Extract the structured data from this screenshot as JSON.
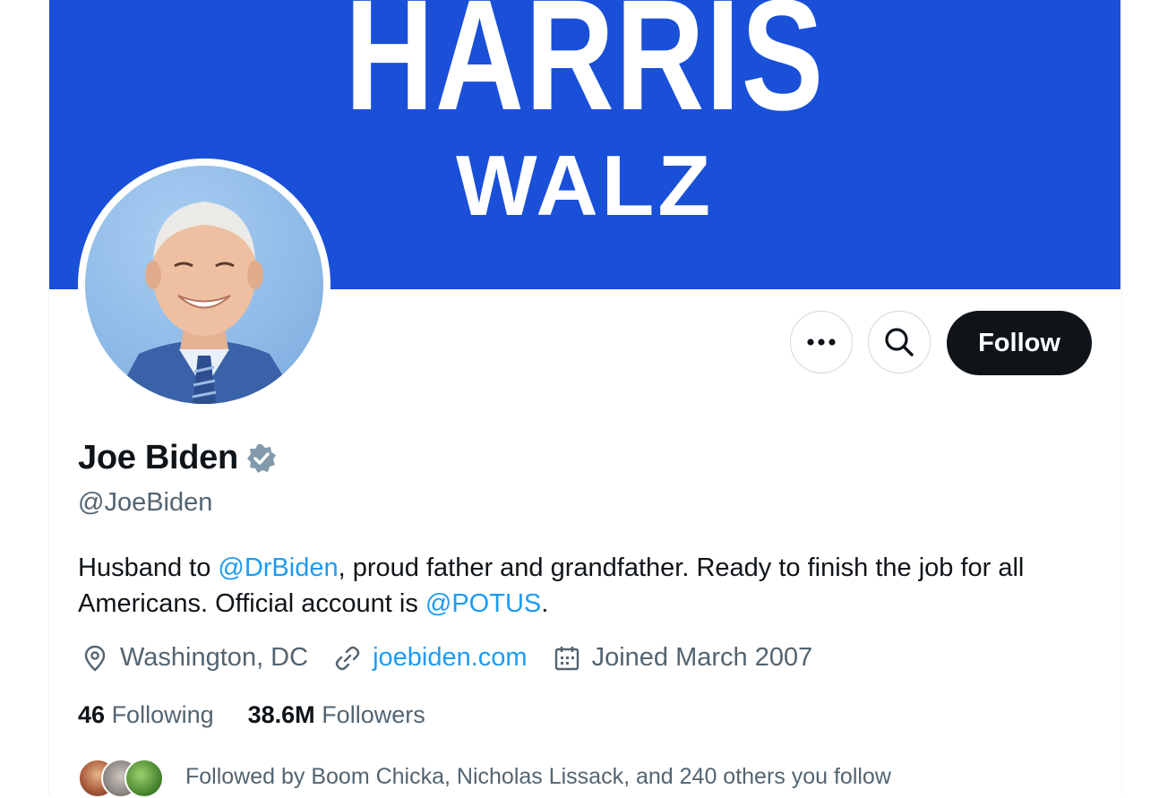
{
  "banner": {
    "line1": "HARRIS",
    "line2": "WALZ",
    "color": "#1a50d8"
  },
  "actions": {
    "more_icon": "more-horizontal-icon",
    "search_icon": "search-icon",
    "follow_label": "Follow"
  },
  "profile": {
    "name": "Joe Biden",
    "verified_icon": "verified-badge-icon",
    "handle": "@JoeBiden",
    "bio": {
      "part1": "Husband to ",
      "mention1": "@DrBiden",
      "part2": ", proud father and grandfather. Ready to finish the job for all Americans. Official account is ",
      "mention2": "@POTUS",
      "part3": "."
    },
    "location": "Washington, DC",
    "website": "joebiden.com",
    "joined": "Joined March 2007",
    "following_count": "46",
    "following_label": "Following",
    "followers_count": "38.6M",
    "followers_label": "Followers",
    "followed_by": "Followed by Boom Chicka, Nicholas Lissack, and 240 others you follow"
  },
  "colors": {
    "link": "#1d9bf0",
    "secondary_text": "#536471",
    "primary_text": "#0f1419"
  }
}
